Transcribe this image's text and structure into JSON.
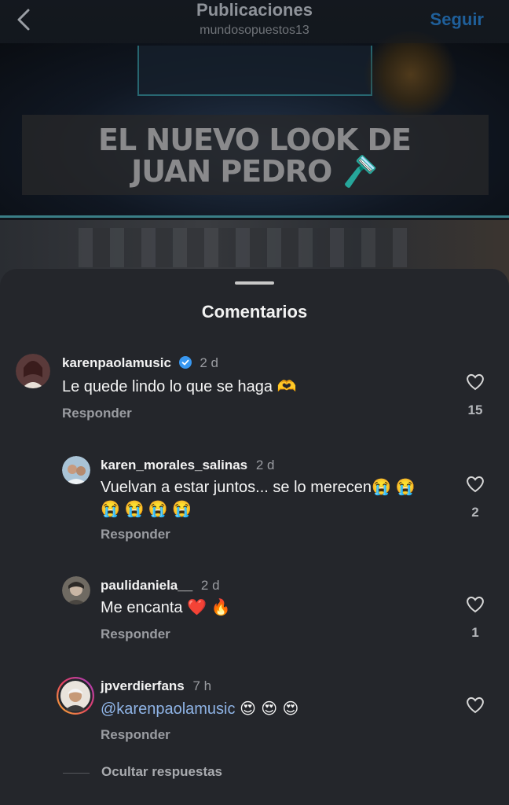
{
  "header": {
    "title": "Publicaciones",
    "subtitle": "mundosopuestos13",
    "follow_label": "Seguir"
  },
  "post": {
    "headline_line1": "EL NUEVO LOOK DE",
    "headline_line2": "JUAN PEDRO 🪒"
  },
  "comments_sheet": {
    "title": "Comentarios",
    "hide_replies_label": "Ocultar respuestas",
    "reply_label": "Responder",
    "comments": [
      {
        "username": "karenpaola​music",
        "verified": true,
        "time": "2 d",
        "text": "Le quede lindo lo que se haga 🫶",
        "likes": "15"
      },
      {
        "username": "karen_morales_salinas",
        "time": "2 d",
        "text_line1": "Vuelvan a estar juntos... se lo merecen😭 😭",
        "text_line2": "😭 😭 😭 😭",
        "likes": "2"
      },
      {
        "username": "paulidaniela__",
        "time": "2 d",
        "text": "Me encanta ❤️ 🔥",
        "likes": "1"
      },
      {
        "username": "jpverdierfans",
        "time": "7 h",
        "mention": "@karenpaolamusic",
        "emojis": "😍 😍 😍"
      }
    ]
  },
  "colors": {
    "sheet_bg": "#24262b",
    "verified_blue": "#3897f0",
    "follow_blue": "#1f5f9a",
    "mention_blue": "#8fb4e6"
  }
}
